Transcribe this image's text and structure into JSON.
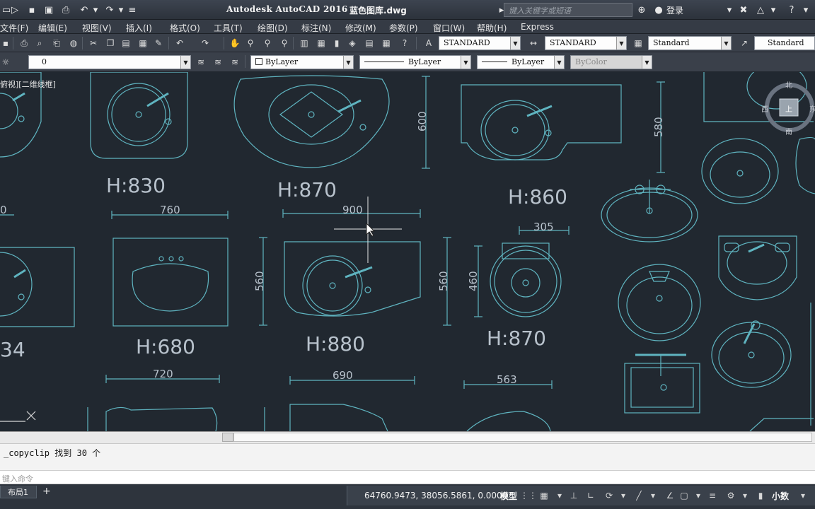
{
  "titlebar": {
    "app_title": "Autodesk AutoCAD 2016",
    "doc_title": "蓝色图库.dwg",
    "search_placeholder": "键入关键字或短语",
    "login": "登录"
  },
  "menu": [
    "文件(F)",
    "编辑(E)",
    "视图(V)",
    "插入(I)",
    "格式(O)",
    "工具(T)",
    "绘图(D)",
    "标注(N)",
    "修改(M)",
    "参数(P)",
    "窗口(W)",
    "帮助(H)",
    "Express"
  ],
  "toolbar1": {
    "text_style": "STANDARD",
    "dim_style": "STANDARD",
    "table_style": "Standard",
    "mleader_style": "Standard"
  },
  "toolbar2": {
    "layer": "0",
    "color": "ByLayer",
    "linetype": "ByLayer",
    "lineweight": "ByLayer",
    "plot_style": "ByColor"
  },
  "canvas": {
    "view_label": "俯视][二维线框]",
    "compass": {
      "north": "北",
      "south": "南",
      "east": "东",
      "west": "西",
      "top": "上"
    },
    "labels": {
      "h830": "H:830",
      "h870a": "H:870",
      "h860": "H:860",
      "h680": "H:680",
      "h880": "H:880",
      "h870b": "H:870",
      "d760": "760",
      "d900": "900",
      "d305": "305",
      "d720": "720",
      "d690": "690",
      "d563": "563",
      "v600": "600",
      "v580": "580",
      "v560a": "560",
      "v560b": "560",
      "v460": "460",
      "left0": "0",
      "left34": "34"
    }
  },
  "command": {
    "history": "_copyclip 找到 30 个",
    "placeholder": "键入命令"
  },
  "status": {
    "layout_tab": "布局1",
    "add_tab": "+",
    "coords": "64760.9473, 38056.5861, 0.0000",
    "model": "模型",
    "units": "小数"
  }
}
